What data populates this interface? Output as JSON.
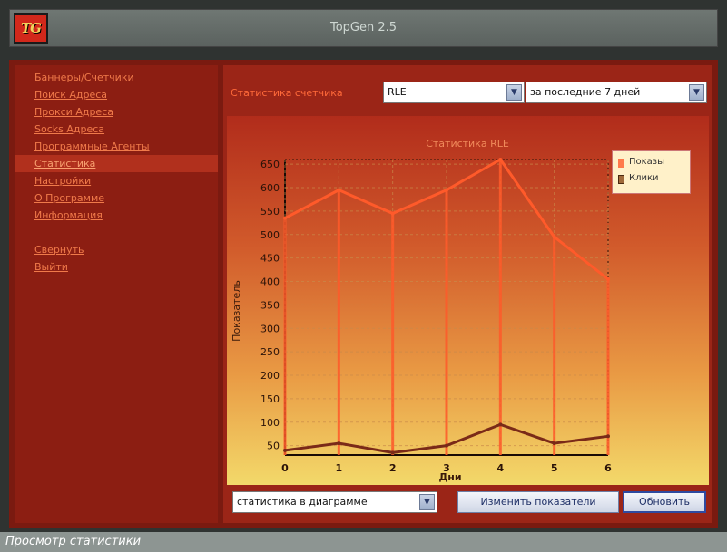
{
  "window": {
    "title": "TopGen 2.5",
    "logo_text": "TG"
  },
  "sidebar": {
    "items": [
      {
        "label": "Баннеры/Счетчики",
        "active": false
      },
      {
        "label": "Поиск Адреса",
        "active": false
      },
      {
        "label": "Прокси Адреса",
        "active": false
      },
      {
        "label": "Socks Адреса",
        "active": false
      },
      {
        "label": "Программные Агенты",
        "active": false
      },
      {
        "label": "Статистика",
        "active": true
      },
      {
        "label": "Настройки",
        "active": false
      },
      {
        "label": "О Программе",
        "active": false
      },
      {
        "label": "Информация",
        "active": false
      }
    ],
    "secondary_items": [
      {
        "label": "Свернуть"
      },
      {
        "label": "Выйти"
      }
    ]
  },
  "stats": {
    "label": "Статистика счетчика",
    "counter_select": "RLE",
    "period_select": "за последние 7 дней",
    "view_select": "статистика в диаграмме",
    "change_button": "Изменить показатели",
    "refresh_button": "Обновить"
  },
  "chart_data": {
    "type": "line",
    "title": "Статистика RLE",
    "xlabel": "Дни",
    "ylabel": "Показатель",
    "x": [
      0,
      1,
      2,
      3,
      4,
      5,
      6
    ],
    "ylim": [
      30,
      660
    ],
    "yticks": [
      50,
      100,
      150,
      200,
      250,
      300,
      350,
      400,
      450,
      500,
      550,
      600,
      650
    ],
    "grid": true,
    "legend_position": "top-right",
    "series": [
      {
        "name": "Показы",
        "values": [
          535,
          595,
          545,
          595,
          665,
          495,
          405
        ],
        "color": "#ff5a2a"
      },
      {
        "name": "Клики",
        "values": [
          40,
          55,
          35,
          50,
          95,
          55,
          70
        ],
        "color": "#7a2a18"
      }
    ]
  },
  "caption": "Просмотр статистики"
}
